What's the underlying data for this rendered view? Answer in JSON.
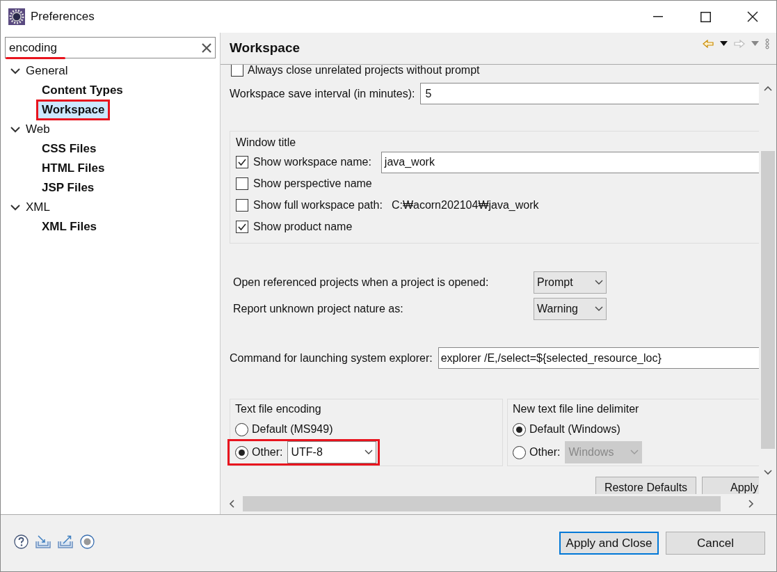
{
  "window": {
    "title": "Preferences"
  },
  "filter": {
    "value": "encoding",
    "underlined": true
  },
  "tree": [
    {
      "label": "General",
      "expanded": true,
      "children": [
        {
          "label": "Content Types",
          "selected": false,
          "highlighted": false
        },
        {
          "label": "Workspace",
          "selected": true,
          "highlighted": true
        }
      ]
    },
    {
      "label": "Web",
      "expanded": true,
      "children": [
        {
          "label": "CSS Files",
          "selected": false,
          "highlighted": false
        },
        {
          "label": "HTML Files",
          "selected": false,
          "highlighted": false
        },
        {
          "label": "JSP Files",
          "selected": false,
          "highlighted": false
        }
      ]
    },
    {
      "label": "XML",
      "expanded": true,
      "children": [
        {
          "label": "XML Files",
          "selected": false,
          "highlighted": false
        }
      ]
    }
  ],
  "page": {
    "title": "Workspace",
    "always_close": {
      "label": "Always close unrelated projects without prompt",
      "checked": false
    },
    "save_interval": {
      "label": "Workspace save interval (in minutes):",
      "value": "5"
    },
    "window_title": {
      "legend": "Window title",
      "options": [
        {
          "label": "Show workspace name:",
          "checked": true,
          "value": "java_work"
        },
        {
          "label": "Show perspective name",
          "checked": false
        },
        {
          "label": "Show full workspace path:",
          "checked": false,
          "path": "C:₩acorn202104₩java_work"
        },
        {
          "label": "Show product name",
          "checked": true
        }
      ]
    },
    "dropdowns": [
      {
        "label": "Open referenced projects when a project is opened:",
        "value": "Prompt"
      },
      {
        "label": "Report unknown project nature as:",
        "value": "Warning"
      }
    ],
    "explorer": {
      "label": "Command for launching system explorer:",
      "value": "explorer /E,/select=${selected_resource_loc}"
    },
    "encoding": {
      "legend": "Text file encoding",
      "highlighted": true,
      "options": [
        {
          "label": "Default (MS949)",
          "selected": false
        },
        {
          "label": "Other:",
          "selected": true,
          "value": "UTF-8"
        }
      ]
    },
    "delimiter": {
      "legend": "New text file line delimiter",
      "highlighted": false,
      "options": [
        {
          "label": "Default (Windows)",
          "selected": true
        },
        {
          "label": "Other:",
          "selected": false,
          "value": "Windows"
        }
      ]
    },
    "buttons": [
      "Restore Defaults",
      "Apply"
    ]
  },
  "footer_buttons": [
    {
      "label": "Apply and Close",
      "default": true
    },
    {
      "label": "Cancel",
      "default": false
    }
  ]
}
